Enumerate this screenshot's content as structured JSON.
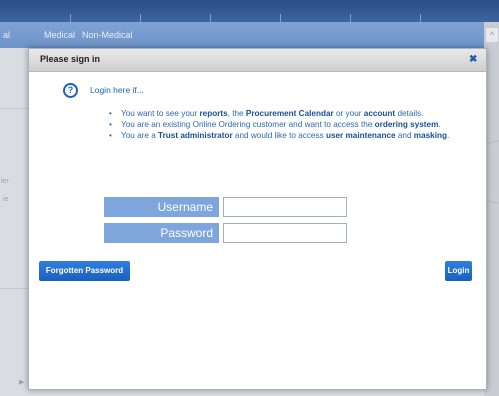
{
  "background": {
    "nav": [
      "al",
      "Medical",
      "Non-Medical"
    ],
    "side_text_1": "ler",
    "side_text_2": "ie"
  },
  "modal": {
    "title": "Please sign in",
    "close_icon": "close-icon",
    "intro": "Login here if...",
    "bullets": [
      {
        "pre": "You want to see your ",
        "b1": "reports",
        "mid1": ", the ",
        "b2": "Procurement Calendar",
        "mid2": " or your ",
        "b3": "account",
        "post": " details."
      },
      {
        "pre": "You are an existing Online Ordering customer and want to access the ",
        "b1": "ordering system",
        "post": "."
      },
      {
        "pre": "You are a ",
        "b1": "Trust administrator",
        "mid1": " and would like to access ",
        "b2": "user maintenance",
        "mid2": " and ",
        "b3": "masking",
        "post": "."
      }
    ],
    "username_label": "Username",
    "username_value": "",
    "password_label": "Password",
    "password_value": "",
    "forgot_label": "Forgotten Password",
    "login_label": "Login"
  }
}
